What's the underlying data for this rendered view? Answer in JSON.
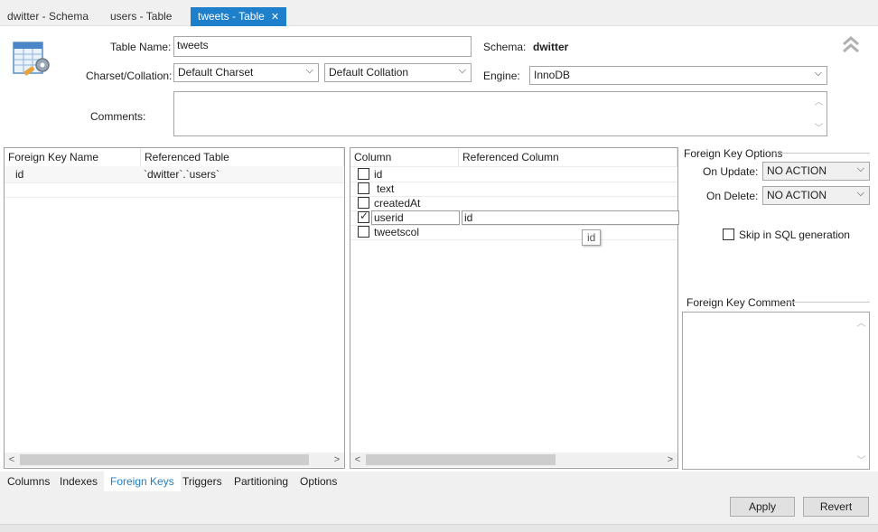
{
  "tabs": [
    {
      "label": "dwitter - Schema"
    },
    {
      "label": "users - Table"
    },
    {
      "label": "tweets - Table",
      "active": true
    }
  ],
  "form": {
    "table_name_label": "Table Name:",
    "table_name_value": "tweets",
    "schema_label": "Schema:",
    "schema_value": "dwitter",
    "charset_label": "Charset/Collation:",
    "charset_value": "Default Charset",
    "collation_value": "Default Collation",
    "engine_label": "Engine:",
    "engine_value": "InnoDB",
    "comments_label": "Comments:"
  },
  "fk_list": {
    "headers": [
      "Foreign Key Name",
      "Referenced Table"
    ],
    "rows": [
      {
        "name": "id",
        "table": "`dwitter`.`users`"
      }
    ]
  },
  "columns": {
    "headers": [
      "Column",
      "Referenced Column"
    ],
    "rows": [
      {
        "name": "id",
        "checked": false,
        "ref": ""
      },
      {
        "name": "text",
        "checked": false,
        "ref": ""
      },
      {
        "name": "createdAt",
        "checked": false,
        "ref": ""
      },
      {
        "name": "userid",
        "checked": true,
        "ref": "id"
      },
      {
        "name": "tweetscol",
        "checked": false,
        "ref": ""
      }
    ],
    "tooltip": "id"
  },
  "options": {
    "group_label": "Foreign Key Options",
    "on_update_label": "On Update:",
    "on_update_value": "NO ACTION",
    "on_delete_label": "On Delete:",
    "on_delete_value": "NO ACTION",
    "skip_sql_label": "Skip in SQL generation",
    "comment_label": "Foreign Key Comment"
  },
  "bottom_tabs": [
    {
      "label": "Columns"
    },
    {
      "label": "Indexes"
    },
    {
      "label": "Foreign Keys",
      "active": true
    },
    {
      "label": "Triggers"
    },
    {
      "label": "Partitioning"
    },
    {
      "label": "Options"
    }
  ],
  "buttons": {
    "apply": "Apply",
    "revert": "Revert"
  },
  "colors": {
    "accent": "#1e7fcb",
    "panel_border": "#a0a0a0",
    "background": "#f0f0f0"
  }
}
